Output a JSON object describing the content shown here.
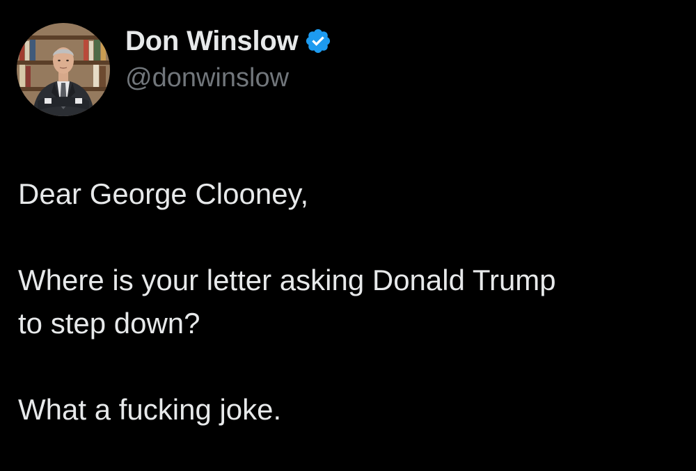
{
  "author": {
    "display_name": "Don Winslow",
    "handle": "@donwinslow",
    "verified": true,
    "verified_icon": "verified-badge-icon",
    "avatar_icon": "profile-photo"
  },
  "tweet": {
    "greeting": "Dear George Clooney,",
    "question_line1": "Where is your letter asking Donald Trump",
    "question_line2": "to step down?",
    "closing": "What a fucking joke."
  },
  "colors": {
    "background": "#000000",
    "text": "#e7e9ea",
    "handle": "#71767b",
    "verified": "#1d9bf0"
  }
}
